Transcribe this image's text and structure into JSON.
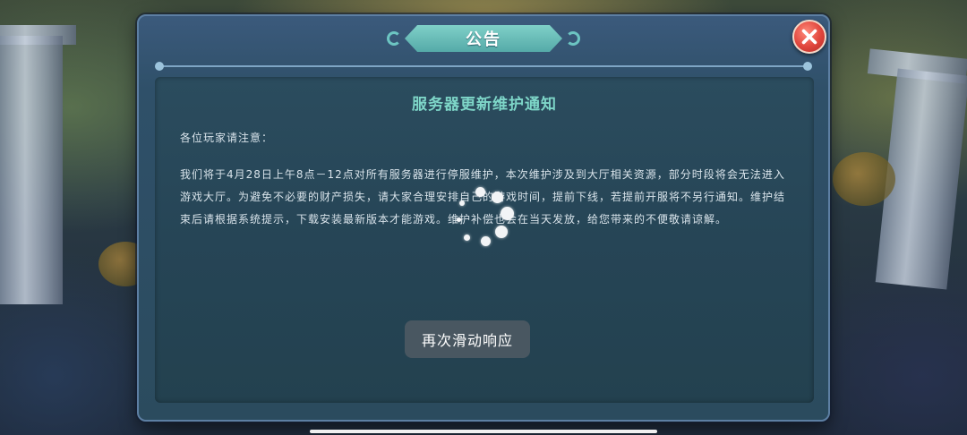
{
  "dialog": {
    "title": "公告",
    "close_icon": "close-x-icon",
    "heading": "服务器更新维护通知",
    "greeting": "各位玩家请注意：",
    "body": "我们将于4月28日上午8点－12点对所有服务器进行停服维护，本次维护涉及到大厅相关资源，部分时段将会无法进入游戏大厅。为避免不必要的财产损失，请大家合理安排自己的游戏时间，提前下线，若提前开服将不另行通知。维护结束后请根据系统提示，下载安装最新版本才能游戏。维护补偿也会在当天发放，给您带来的不便敬请谅解。"
  },
  "loading": {
    "icon": "loading-spinner-icon"
  },
  "toast": {
    "text": "再次滑动响应"
  },
  "colors": {
    "heading": "#7ed6c8",
    "title_plaque": "#6cc5c2",
    "close_button": "#e0453c",
    "dialog_frame": "#3b5a7c"
  }
}
